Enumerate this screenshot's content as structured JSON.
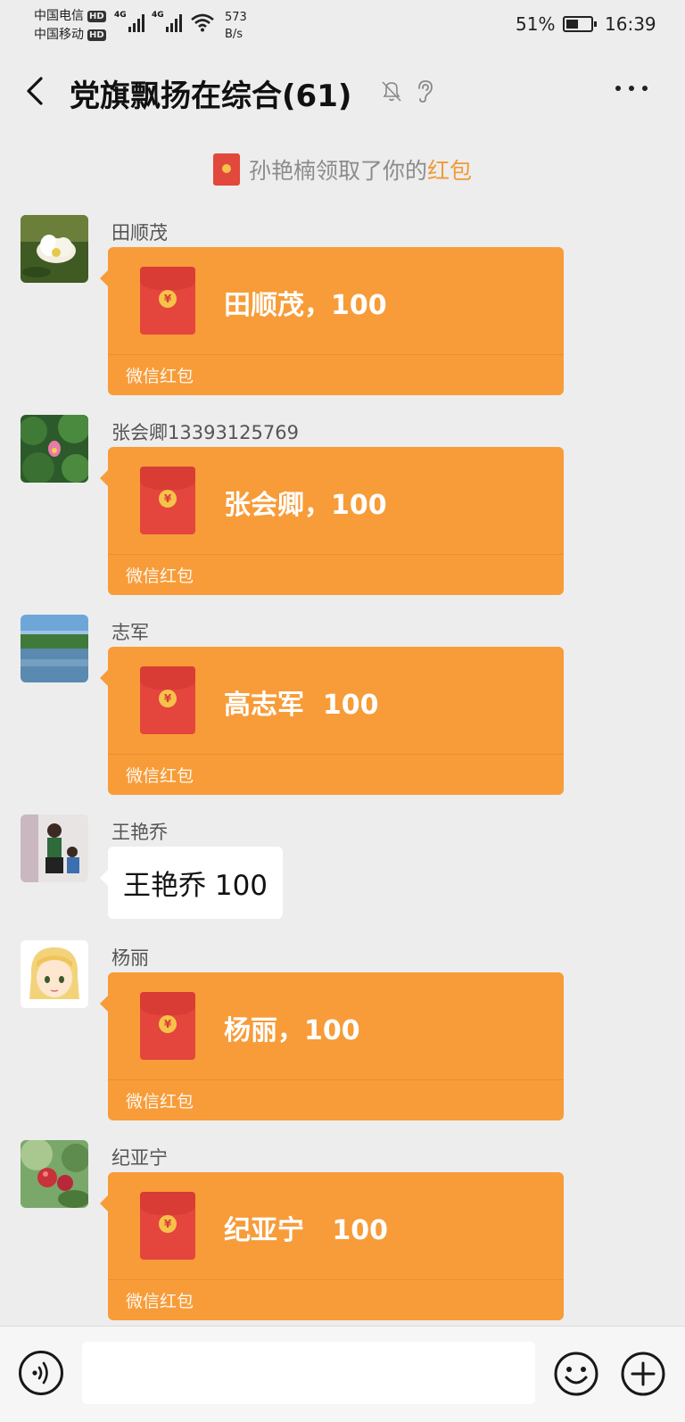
{
  "status_bar": {
    "carrier_1": "中国电信",
    "carrier_2": "中国移动",
    "hd_badge": "HD",
    "network_1": "4G",
    "network_2": "4G",
    "net_speed_value": "573",
    "net_speed_unit": "B/s",
    "battery_text": "51%",
    "battery_level": 0.51,
    "time": "16:39"
  },
  "header": {
    "title": "党旗飘扬在综合(61)",
    "back_icon": "chevron-left-icon",
    "mute_icon": "bell-muted-icon",
    "earpiece_icon": "ear-icon",
    "more_icon": "more-dots-icon"
  },
  "system_notice": {
    "prefix": "孙艳楠领取了你的",
    "highlight": "红包",
    "highlight_color": "#f09a37"
  },
  "messages": [
    {
      "sender": "田顺茂",
      "type": "red_packet",
      "text": "田顺茂，100",
      "footer": "微信红包"
    },
    {
      "sender": "张会卿13393125769",
      "type": "red_packet",
      "text": "张会卿，100",
      "footer": "微信红包"
    },
    {
      "sender": "志军",
      "type": "red_packet",
      "text": "高志军  100",
      "footer": "微信红包"
    },
    {
      "sender": "王艳乔",
      "type": "text",
      "text": "王艳乔 100"
    },
    {
      "sender": "杨丽",
      "type": "red_packet",
      "text": "杨丽，100",
      "footer": "微信红包"
    },
    {
      "sender": "纪亚宁",
      "type": "red_packet",
      "text": "纪亚宁   100",
      "footer": "微信红包"
    }
  ],
  "input_bar": {
    "voice_icon": "voice-icon",
    "emoji_icon": "emoji-icon",
    "plus_icon": "plus-circle-icon",
    "input_value": ""
  },
  "colors": {
    "background": "#ededed",
    "red_packet_bubble": "#f79c39",
    "red_packet_envelope": "#e4453d",
    "text_bubble": "#ffffff"
  }
}
